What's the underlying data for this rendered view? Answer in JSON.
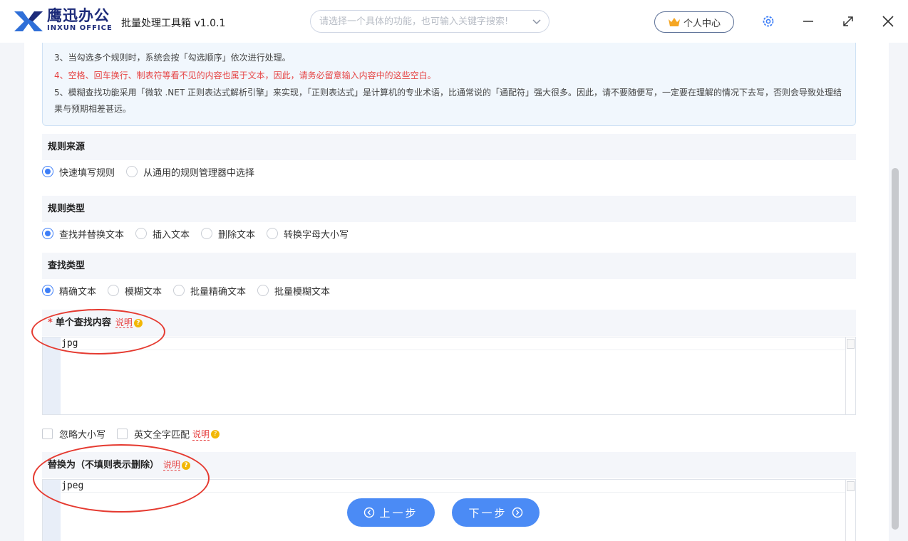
{
  "header": {
    "brand_cn": "鹰迅办公",
    "brand_en": "INXUN OFFICE",
    "app_title": "批量处理工具箱 v1.0.1",
    "search_placeholder": "请选择一个具体的功能，也可输入关键字搜索!",
    "user_center": "个人中心",
    "icons": [
      "settings-icon",
      "minimize-icon",
      "maximize-icon",
      "close-icon"
    ]
  },
  "notes": [
    {
      "text": "3、当勾选多个规则时，系统会按「勾选顺序」依次进行处理。",
      "color": "#444444"
    },
    {
      "text": "4、空格、回车换行、制表符等看不见的内容也属于文本，因此，请务必留意输入内容中的这些空白。",
      "color": "#e64545"
    },
    {
      "text": "5、模糊查找功能采用「微软 .NET 正则表达式解析引擎」来实现，「正则表达式」是计算机的专业术语，比通常说的「通配符」强大很多。因此，请不要随便写，一定要在理解的情况下去写，否则会导致处理结",
      "color": "#444444"
    },
    {
      "text": "果与预期相差甚远。",
      "color": "#444444"
    }
  ],
  "rule_source": {
    "title": "规则来源",
    "options": [
      "快速填写规则",
      "从通用的规则管理器中选择"
    ],
    "selected": 0
  },
  "rule_type": {
    "title": "规则类型",
    "options": [
      "查找并替换文本",
      "插入文本",
      "删除文本",
      "转换字母大小写"
    ],
    "selected": 0
  },
  "find_type": {
    "title": "查找类型",
    "options": [
      "精确文本",
      "模糊文本",
      "批量精确文本",
      "批量模糊文本"
    ],
    "selected": 0
  },
  "find_content": {
    "required_mark": "*",
    "title": "单个查找内容",
    "hint": "说明",
    "value": "jpg"
  },
  "options": {
    "ignore_case": "忽略大小写",
    "whole_word": "英文全字匹配",
    "hint": "说明"
  },
  "replace": {
    "title": "替换为（不填则表示删除）",
    "hint": "说明",
    "value": "jpeg"
  },
  "nav": {
    "prev": "上一步",
    "next": "下一步"
  },
  "colors": {
    "accent": "#4b8bf5",
    "brand": "#1d2b7a",
    "warning_text": "#e64545",
    "annotation": "#e53a30"
  }
}
